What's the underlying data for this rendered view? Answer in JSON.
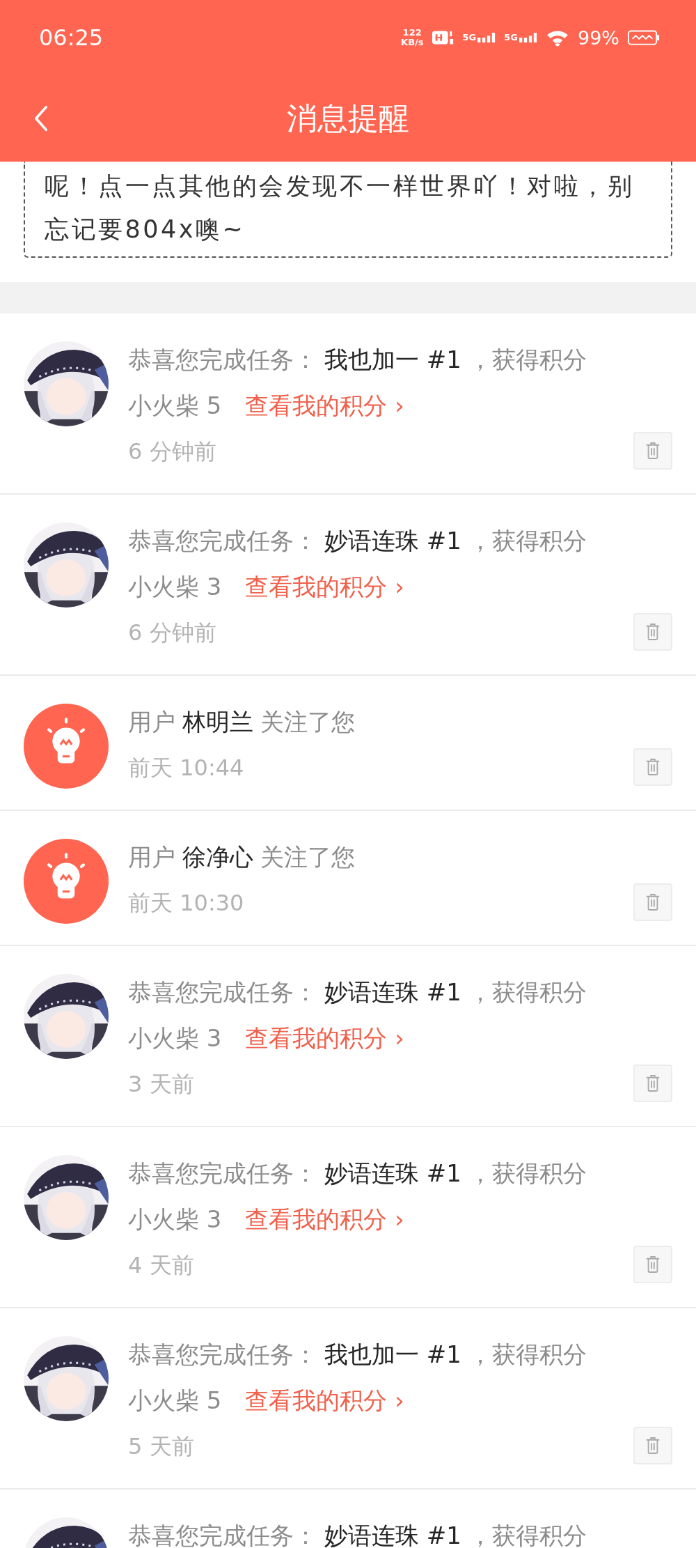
{
  "status_bar": {
    "time": "06:25",
    "net_speed_value": "122",
    "net_speed_unit": "KB/s",
    "sim_labels": [
      "5G",
      "5G"
    ],
    "battery": "99%"
  },
  "header": {
    "title": "消息提醒"
  },
  "notice": {
    "text": "呢！点一点其他的会发现不一样世界吖！对啦，别忘记要804x噢~"
  },
  "messages": [
    {
      "kind": "task",
      "intro": "恭喜您完成任务：",
      "task_name": "我也加一 #1",
      "reward_label": "，获得积分",
      "reward": "小火柴 5",
      "link": "查看我的积分 ›",
      "time": "6 分钟前"
    },
    {
      "kind": "task",
      "intro": "恭喜您完成任务：",
      "task_name": "妙语连珠 #1",
      "reward_label": "，获得积分",
      "reward": "小火柴 3",
      "link": "查看我的积分 ›",
      "time": "6 分钟前"
    },
    {
      "kind": "follow",
      "prefix": "用户",
      "user": "林明兰",
      "action": "关注了您",
      "time": "前天 10:44"
    },
    {
      "kind": "follow",
      "prefix": "用户",
      "user": "徐净心",
      "action": "关注了您",
      "time": "前天 10:30"
    },
    {
      "kind": "task",
      "intro": "恭喜您完成任务：",
      "task_name": "妙语连珠 #1",
      "reward_label": "，获得积分",
      "reward": "小火柴 3",
      "link": "查看我的积分 ›",
      "time": "3 天前"
    },
    {
      "kind": "task",
      "intro": "恭喜您完成任务：",
      "task_name": "妙语连珠 #1",
      "reward_label": "，获得积分",
      "reward": "小火柴 3",
      "link": "查看我的积分 ›",
      "time": "4 天前"
    },
    {
      "kind": "task",
      "intro": "恭喜您完成任务：",
      "task_name": "我也加一 #1",
      "reward_label": "，获得积分",
      "reward": "小火柴 5",
      "link": "查看我的积分 ›",
      "time": "5 天前"
    },
    {
      "kind": "task",
      "intro": "恭喜您完成任务：",
      "task_name": "妙语连珠 #1",
      "reward_label": "，获得积分"
    }
  ]
}
